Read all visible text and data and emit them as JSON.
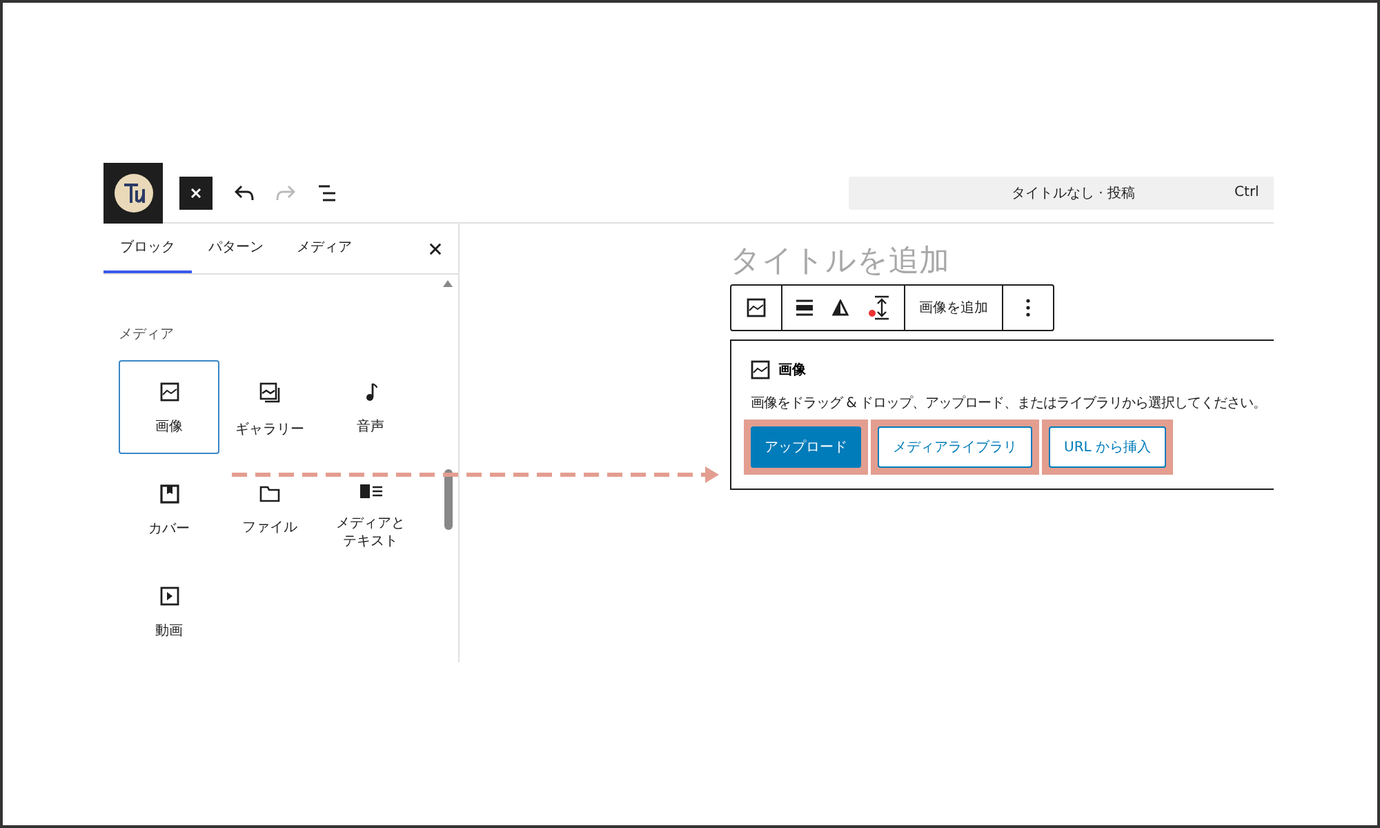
{
  "header": {
    "document_title": "タイトルなし · 投稿",
    "shortcut": "Ctrl"
  },
  "sidebar": {
    "tabs": [
      {
        "label": "ブロック",
        "selected": true
      },
      {
        "label": "パターン",
        "selected": false
      },
      {
        "label": "メディア",
        "selected": false
      }
    ],
    "category": "メディア",
    "blocks": [
      {
        "label": "画像",
        "kind": "image",
        "selected": true
      },
      {
        "label": "ギャラリー",
        "kind": "gallery",
        "selected": false
      },
      {
        "label": "音声",
        "kind": "audio",
        "selected": false
      },
      {
        "label": "カバー",
        "kind": "cover",
        "selected": false
      },
      {
        "label": "ファイル",
        "kind": "file",
        "selected": false
      },
      {
        "label": "メディアとテキスト",
        "kind": "media-text",
        "selected": false
      },
      {
        "label": "動画",
        "kind": "video",
        "selected": false
      }
    ]
  },
  "editor": {
    "title_placeholder": "タイトルを追加",
    "toolbar": {
      "add_image": "画像を追加"
    },
    "image_block": {
      "title": "画像",
      "instructions": "画像をドラッグ & ドロップ、アップロード、またはライブラリから選択してください。",
      "buttons": [
        {
          "label": "アップロード",
          "kind": "primary",
          "highlighted": true
        },
        {
          "label": "メディアライブラリ",
          "kind": "secondary",
          "highlighted": true
        },
        {
          "label": "URL から挿入",
          "kind": "secondary",
          "highlighted": true
        }
      ]
    }
  }
}
